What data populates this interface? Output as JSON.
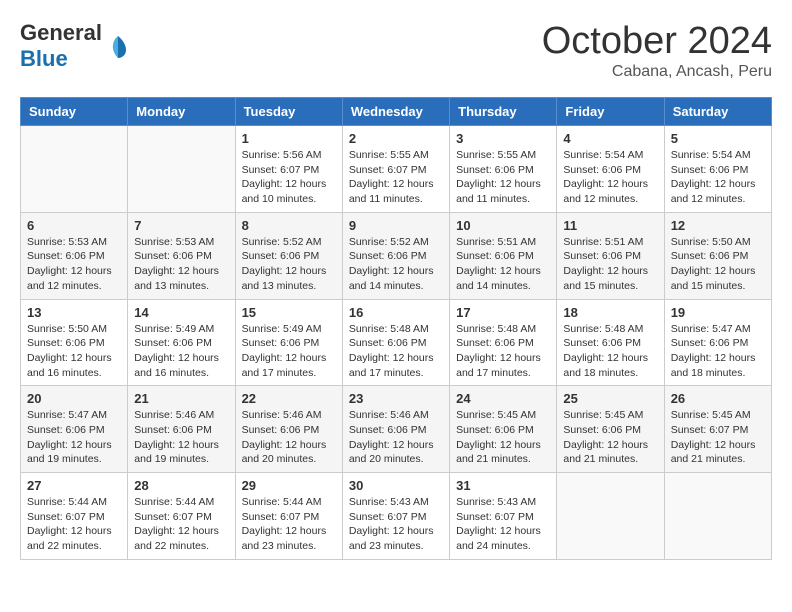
{
  "header": {
    "logo_general": "General",
    "logo_blue": "Blue",
    "month": "October 2024",
    "location": "Cabana, Ancash, Peru"
  },
  "weekdays": [
    "Sunday",
    "Monday",
    "Tuesday",
    "Wednesday",
    "Thursday",
    "Friday",
    "Saturday"
  ],
  "weeks": [
    [
      {
        "day": "",
        "info": ""
      },
      {
        "day": "",
        "info": ""
      },
      {
        "day": "1",
        "info": "Sunrise: 5:56 AM\nSunset: 6:07 PM\nDaylight: 12 hours and 10 minutes."
      },
      {
        "day": "2",
        "info": "Sunrise: 5:55 AM\nSunset: 6:07 PM\nDaylight: 12 hours and 11 minutes."
      },
      {
        "day": "3",
        "info": "Sunrise: 5:55 AM\nSunset: 6:06 PM\nDaylight: 12 hours and 11 minutes."
      },
      {
        "day": "4",
        "info": "Sunrise: 5:54 AM\nSunset: 6:06 PM\nDaylight: 12 hours and 12 minutes."
      },
      {
        "day": "5",
        "info": "Sunrise: 5:54 AM\nSunset: 6:06 PM\nDaylight: 12 hours and 12 minutes."
      }
    ],
    [
      {
        "day": "6",
        "info": "Sunrise: 5:53 AM\nSunset: 6:06 PM\nDaylight: 12 hours and 12 minutes."
      },
      {
        "day": "7",
        "info": "Sunrise: 5:53 AM\nSunset: 6:06 PM\nDaylight: 12 hours and 13 minutes."
      },
      {
        "day": "8",
        "info": "Sunrise: 5:52 AM\nSunset: 6:06 PM\nDaylight: 12 hours and 13 minutes."
      },
      {
        "day": "9",
        "info": "Sunrise: 5:52 AM\nSunset: 6:06 PM\nDaylight: 12 hours and 14 minutes."
      },
      {
        "day": "10",
        "info": "Sunrise: 5:51 AM\nSunset: 6:06 PM\nDaylight: 12 hours and 14 minutes."
      },
      {
        "day": "11",
        "info": "Sunrise: 5:51 AM\nSunset: 6:06 PM\nDaylight: 12 hours and 15 minutes."
      },
      {
        "day": "12",
        "info": "Sunrise: 5:50 AM\nSunset: 6:06 PM\nDaylight: 12 hours and 15 minutes."
      }
    ],
    [
      {
        "day": "13",
        "info": "Sunrise: 5:50 AM\nSunset: 6:06 PM\nDaylight: 12 hours and 16 minutes."
      },
      {
        "day": "14",
        "info": "Sunrise: 5:49 AM\nSunset: 6:06 PM\nDaylight: 12 hours and 16 minutes."
      },
      {
        "day": "15",
        "info": "Sunrise: 5:49 AM\nSunset: 6:06 PM\nDaylight: 12 hours and 17 minutes."
      },
      {
        "day": "16",
        "info": "Sunrise: 5:48 AM\nSunset: 6:06 PM\nDaylight: 12 hours and 17 minutes."
      },
      {
        "day": "17",
        "info": "Sunrise: 5:48 AM\nSunset: 6:06 PM\nDaylight: 12 hours and 17 minutes."
      },
      {
        "day": "18",
        "info": "Sunrise: 5:48 AM\nSunset: 6:06 PM\nDaylight: 12 hours and 18 minutes."
      },
      {
        "day": "19",
        "info": "Sunrise: 5:47 AM\nSunset: 6:06 PM\nDaylight: 12 hours and 18 minutes."
      }
    ],
    [
      {
        "day": "20",
        "info": "Sunrise: 5:47 AM\nSunset: 6:06 PM\nDaylight: 12 hours and 19 minutes."
      },
      {
        "day": "21",
        "info": "Sunrise: 5:46 AM\nSunset: 6:06 PM\nDaylight: 12 hours and 19 minutes."
      },
      {
        "day": "22",
        "info": "Sunrise: 5:46 AM\nSunset: 6:06 PM\nDaylight: 12 hours and 20 minutes."
      },
      {
        "day": "23",
        "info": "Sunrise: 5:46 AM\nSunset: 6:06 PM\nDaylight: 12 hours and 20 minutes."
      },
      {
        "day": "24",
        "info": "Sunrise: 5:45 AM\nSunset: 6:06 PM\nDaylight: 12 hours and 21 minutes."
      },
      {
        "day": "25",
        "info": "Sunrise: 5:45 AM\nSunset: 6:06 PM\nDaylight: 12 hours and 21 minutes."
      },
      {
        "day": "26",
        "info": "Sunrise: 5:45 AM\nSunset: 6:07 PM\nDaylight: 12 hours and 21 minutes."
      }
    ],
    [
      {
        "day": "27",
        "info": "Sunrise: 5:44 AM\nSunset: 6:07 PM\nDaylight: 12 hours and 22 minutes."
      },
      {
        "day": "28",
        "info": "Sunrise: 5:44 AM\nSunset: 6:07 PM\nDaylight: 12 hours and 22 minutes."
      },
      {
        "day": "29",
        "info": "Sunrise: 5:44 AM\nSunset: 6:07 PM\nDaylight: 12 hours and 23 minutes."
      },
      {
        "day": "30",
        "info": "Sunrise: 5:43 AM\nSunset: 6:07 PM\nDaylight: 12 hours and 23 minutes."
      },
      {
        "day": "31",
        "info": "Sunrise: 5:43 AM\nSunset: 6:07 PM\nDaylight: 12 hours and 24 minutes."
      },
      {
        "day": "",
        "info": ""
      },
      {
        "day": "",
        "info": ""
      }
    ]
  ]
}
